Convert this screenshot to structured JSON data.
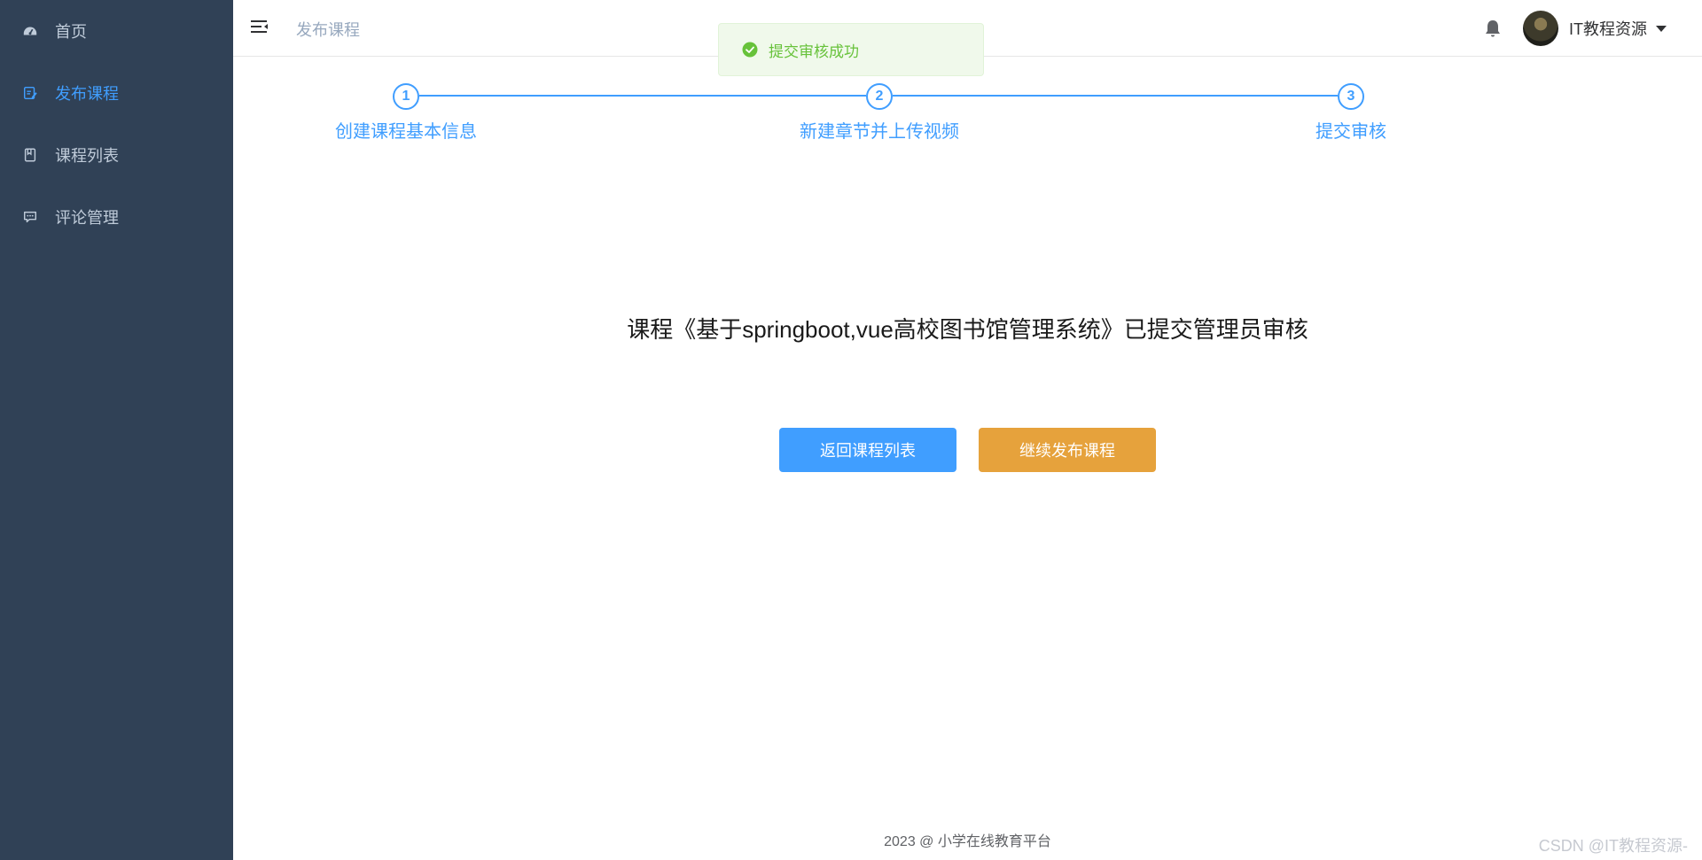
{
  "sidebar": {
    "items": [
      {
        "label": "首页",
        "icon": "dashboard-icon"
      },
      {
        "label": "发布课程",
        "icon": "edit-icon"
      },
      {
        "label": "课程列表",
        "icon": "book-icon"
      },
      {
        "label": "评论管理",
        "icon": "chat-icon"
      }
    ]
  },
  "header": {
    "breadcrumb": "发布课程",
    "user_name": "IT教程资源"
  },
  "toast": {
    "message": "提交审核成功",
    "icon": "check-circle-icon"
  },
  "steps": [
    {
      "number": "1",
      "title": "创建课程基本信息"
    },
    {
      "number": "2",
      "title": "新建章节并上传视频"
    },
    {
      "number": "3",
      "title": "提交审核"
    }
  ],
  "main": {
    "message": "课程《基于springboot,vue高校图书馆管理系统》已提交管理员审核",
    "back_button": "返回课程列表",
    "continue_button": "继续发布课程"
  },
  "footer": {
    "text": "2023 @ 小学在线教育平台"
  },
  "watermark": "CSDN @IT教程资源-",
  "colors": {
    "sidebar_bg": "#304156",
    "active": "#409eff",
    "primary": "#409eff",
    "warning": "#e6a23c",
    "success": "#67c23a"
  }
}
